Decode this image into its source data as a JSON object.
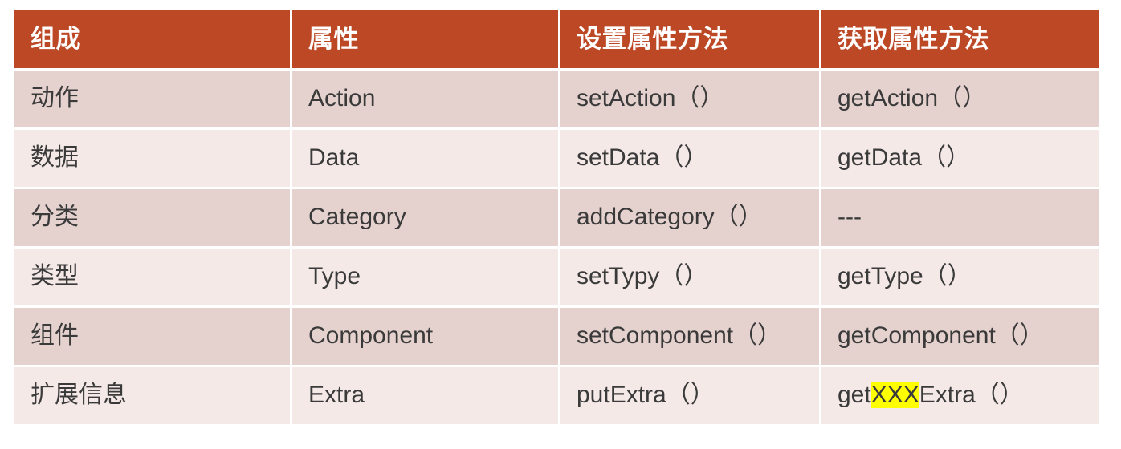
{
  "table": {
    "headers": [
      "组成",
      "属性",
      "设置属性方法",
      "获取属性方法"
    ],
    "rows": [
      {
        "component": "动作",
        "attribute": "Action",
        "setter": "setAction（）",
        "getter_prefix": "getAction（）",
        "getter_highlight": "",
        "getter_suffix": ""
      },
      {
        "component": "数据",
        "attribute": "Data",
        "setter": "setData（）",
        "getter_prefix": "getData（）",
        "getter_highlight": "",
        "getter_suffix": ""
      },
      {
        "component": "分类",
        "attribute": "Category",
        "setter": "addCategory（）",
        "getter_prefix": "---",
        "getter_highlight": "",
        "getter_suffix": ""
      },
      {
        "component": "类型",
        "attribute": "Type",
        "setter": "setTypy（）",
        "getter_prefix": "getType（）",
        "getter_highlight": "",
        "getter_suffix": ""
      },
      {
        "component": "组件",
        "attribute": "Component",
        "setter": "setComponent（）",
        "getter_prefix": "getComponent（）",
        "getter_highlight": "",
        "getter_suffix": ""
      },
      {
        "component": "扩展信息",
        "attribute": "Extra",
        "setter": "putExtra（）",
        "getter_prefix": "get",
        "getter_highlight": "XXX",
        "getter_suffix": "Extra（）"
      }
    ]
  },
  "colors": {
    "header_background": "#bd4825",
    "header_text": "#ffffff",
    "row_dark": "#e5d2ce",
    "row_light": "#f4e9e7",
    "body_text": "#3a3a3a",
    "highlight": "#ffff00",
    "page_background": "#ffffff"
  }
}
